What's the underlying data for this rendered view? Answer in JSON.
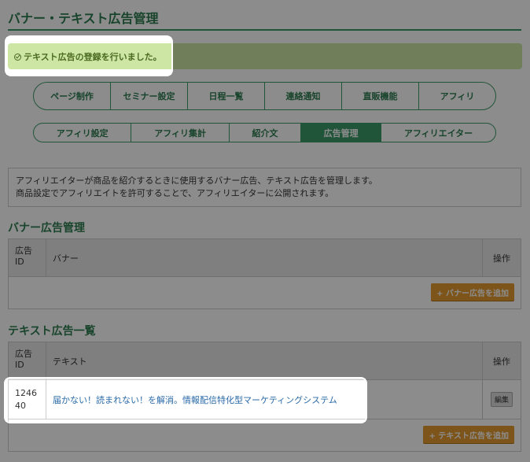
{
  "page": {
    "title": "バナー・テキスト広告管理",
    "notice": "テキスト広告の登録を行いました。"
  },
  "tabs_primary": [
    {
      "label": "ページ制作"
    },
    {
      "label": "セミナー設定"
    },
    {
      "label": "日程一覧"
    },
    {
      "label": "連絡通知"
    },
    {
      "label": "直販機能"
    },
    {
      "label": "アフィリ"
    }
  ],
  "tabs_secondary": [
    {
      "label": "アフィリ設定",
      "active": false
    },
    {
      "label": "アフィリ集計",
      "active": false
    },
    {
      "label": "紹介文",
      "active": false
    },
    {
      "label": "広告管理",
      "active": true
    },
    {
      "label": "アフィリエイター",
      "active": false
    }
  ],
  "description": {
    "line1": "アフィリエイターが商品を紹介するときに使用するバナー広告、テキスト広告を管理します。",
    "line2": "商品設定でアフィリエイトを許可することで、アフィリエイターに公開されます。"
  },
  "banner_section": {
    "title": "バナー広告管理",
    "headers": {
      "id": "広告ID",
      "main": "バナー",
      "action": "操作"
    },
    "add_label": "+ バナー広告を追加"
  },
  "text_section": {
    "title": "テキスト広告一覧",
    "headers": {
      "id": "広告ID",
      "main": "テキスト",
      "action": "操作"
    },
    "rows": [
      {
        "id": "124640",
        "text": "届かない！読まれない！を解消。情報配信特化型マーケティングシステム",
        "edit_label": "編集"
      }
    ],
    "add_label": "+ テキスト広告を追加"
  },
  "colors": {
    "accent": "#3d9c6a",
    "notice_bg": "#cde6a4",
    "button": "#e39a2e",
    "link": "#2a6aa8"
  }
}
